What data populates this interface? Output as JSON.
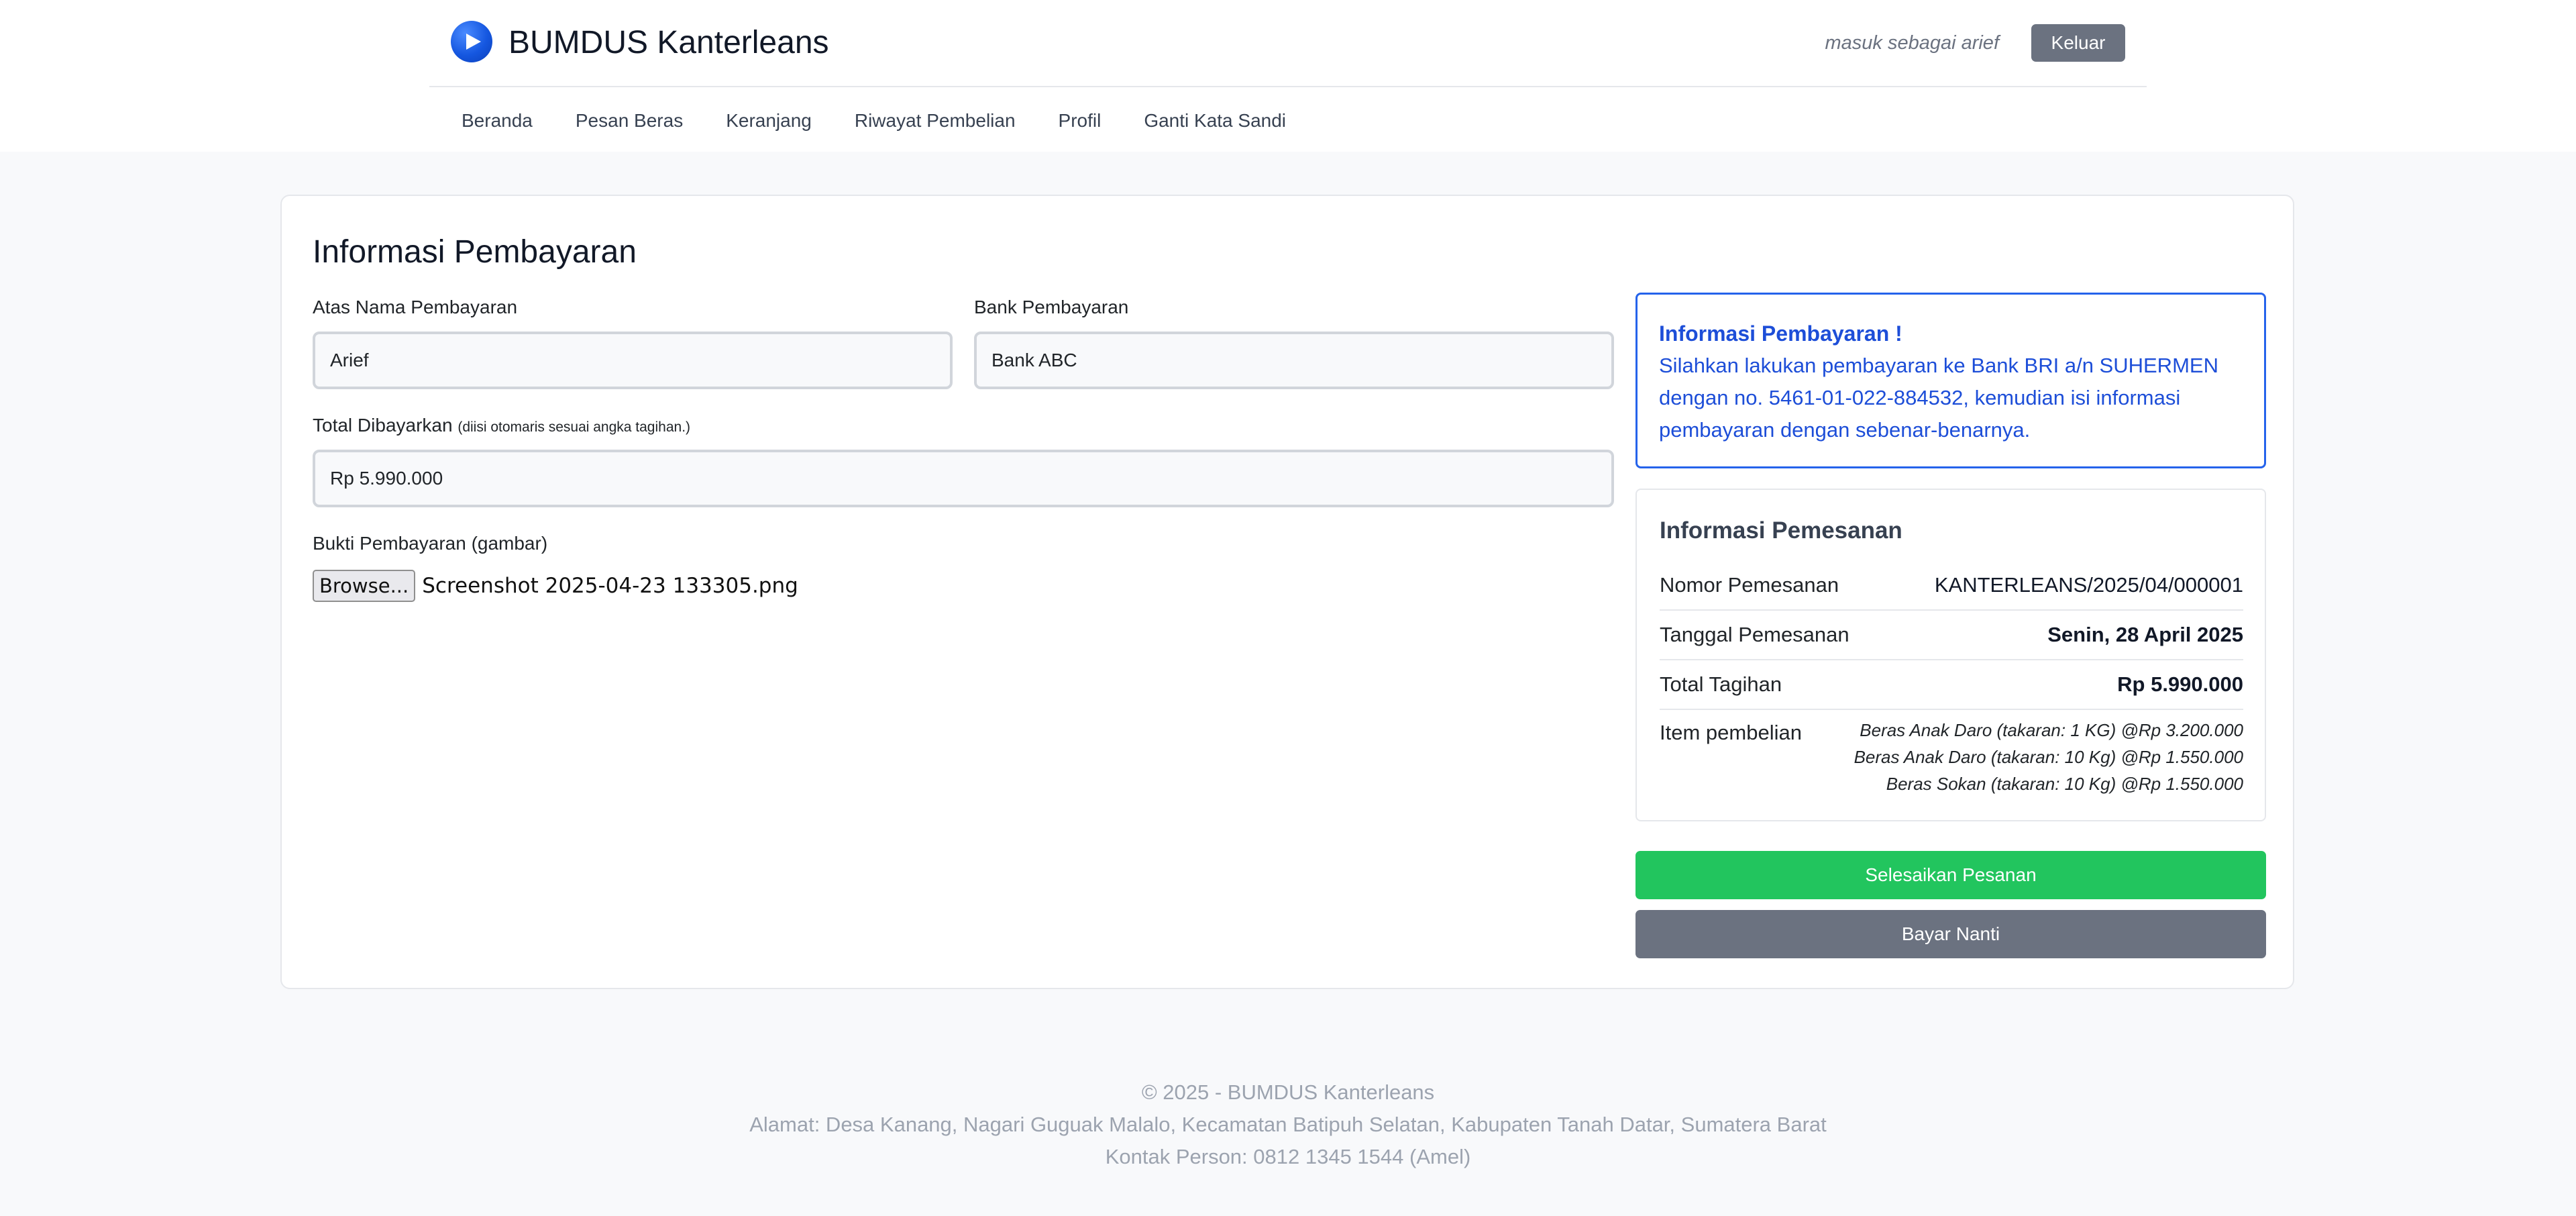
{
  "header": {
    "brand": "BUMDUS Kanterleans",
    "login_text": "masuk sebagai arief",
    "logout_label": "Keluar"
  },
  "nav": {
    "items": [
      "Beranda",
      "Pesan Beras",
      "Keranjang",
      "Riwayat Pembelian",
      "Profil",
      "Ganti Kata Sandi"
    ]
  },
  "payment": {
    "title": "Informasi Pembayaran",
    "name_label": "Atas Nama Pembayaran",
    "name_value": "Arief",
    "bank_label": "Bank Pembayaran",
    "bank_value": "Bank ABC",
    "total_label": "Total Dibayarkan",
    "total_hint": "(diisi otomaris sesuai angka tagihan.)",
    "total_value": "Rp 5.990.000",
    "proof_label": "Bukti Pembayaran (gambar)",
    "browse_label": "Browse...",
    "file_name": "Screenshot 2025-04-23 133305.png"
  },
  "info": {
    "title": "Informasi Pembayaran !",
    "text": "Silahkan lakukan pembayaran ke Bank BRI a/n SUHERMEN dengan no. 5461-01-022-884532, kemudian isi informasi pembayaran dengan sebenar-benarnya."
  },
  "order": {
    "title": "Informasi Pemesanan",
    "number_label": "Nomor Pemesanan",
    "number_value": "KANTERLEANS/2025/04/000001",
    "date_label": "Tanggal Pemesanan",
    "date_value": "Senin, 28 April 2025",
    "total_label": "Total Tagihan",
    "total_value": "Rp 5.990.000",
    "items_label": "Item pembelian",
    "items": [
      "Beras Anak Daro (takaran: 1 KG) @Rp 3.200.000",
      "Beras Anak Daro (takaran: 10 Kg) @Rp 1.550.000",
      "Beras Sokan (takaran: 10 Kg) @Rp 1.550.000"
    ]
  },
  "actions": {
    "finish_label": "Selesaikan Pesanan",
    "later_label": "Bayar Nanti"
  },
  "footer": {
    "copyright": "© 2025 - BUMDUS Kanterleans",
    "address": "Alamat: Desa Kanang, Nagari Guguak Malalo, Kecamatan Batipuh Selatan, Kabupaten Tanah Datar, Sumatera Barat",
    "contact": "Kontak Person: 0812 1345 1544 (Amel)"
  },
  "colors": {
    "primary": "#2563eb",
    "success": "#22c55e",
    "secondary": "#6b7280",
    "background": "#f8f9fb"
  }
}
